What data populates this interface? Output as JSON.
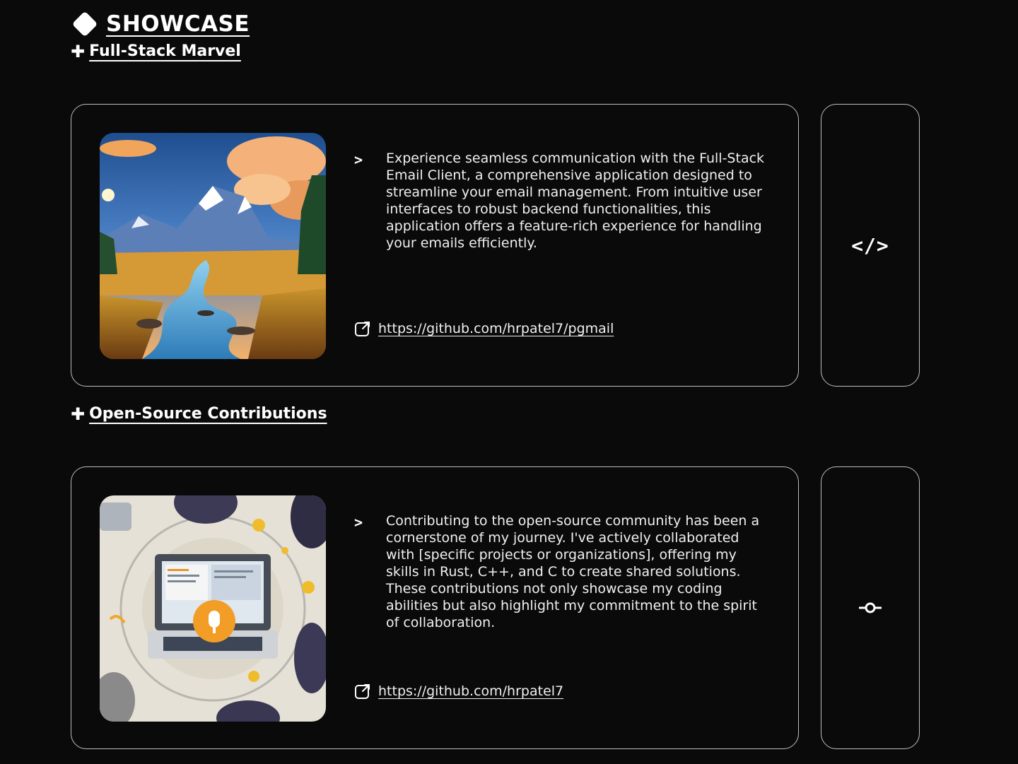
{
  "showcase": {
    "title": "SHOWCASE",
    "icon": "diamond-icon"
  },
  "projects": [
    {
      "heading": "Full-Stack Marvel",
      "heading_icon": "plus-icon",
      "image": "mountain-landscape-image",
      "bullet": ">",
      "description": "Experience seamless communication with the Full-Stack Email Client, a comprehensive application designed to streamline your email management. From intuitive user interfaces to robust backend functionalities, this application offers a feature-rich experience for handling your emails efficiently.",
      "link_icon": "external-link-icon",
      "link": "https://github.com/hrpatel7/pgmail",
      "side_icon": "code-icon",
      "side_label": "</>"
    },
    {
      "heading": "Open-Source Contributions",
      "heading_icon": "plus-icon",
      "image": "laptop-illustration-image",
      "bullet": ">",
      "description": "Contributing to the open-source community has been a cornerstone of my journey. I've actively collaborated with [specific projects or organizations], offering my skills in Rust, C++, and C to create shared solutions. These contributions not only showcase my coding abilities but also highlight my commitment to the spirit of collaboration.",
      "link_icon": "external-link-icon",
      "link": "https://github.com/hrpatel7",
      "side_icon": "git-commit-icon"
    }
  ]
}
